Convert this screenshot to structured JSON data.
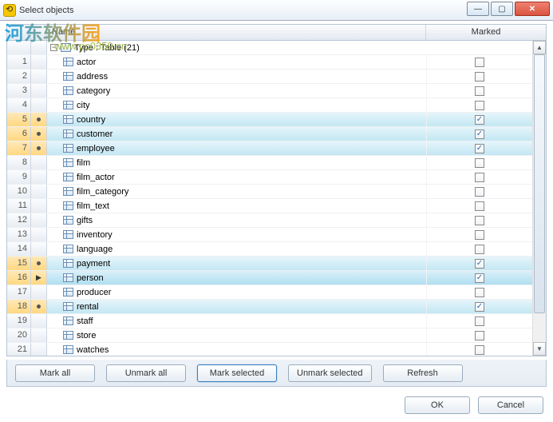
{
  "window": {
    "title": "Select objects"
  },
  "watermark": {
    "text": "河东软件园",
    "url": "www.pc0359.cn"
  },
  "columns": {
    "name": "Name",
    "marked": "Marked"
  },
  "group": {
    "label": "Type : Table (21)"
  },
  "rows": [
    {
      "n": "1",
      "name": "actor",
      "checked": false,
      "sel": false,
      "cur": false,
      "ind": ""
    },
    {
      "n": "2",
      "name": "address",
      "checked": false,
      "sel": false,
      "cur": false,
      "ind": ""
    },
    {
      "n": "3",
      "name": "category",
      "checked": false,
      "sel": false,
      "cur": false,
      "ind": ""
    },
    {
      "n": "4",
      "name": "city",
      "checked": false,
      "sel": false,
      "cur": false,
      "ind": ""
    },
    {
      "n": "5",
      "name": "country",
      "checked": true,
      "sel": true,
      "cur": false,
      "ind": "dot"
    },
    {
      "n": "6",
      "name": "customer",
      "checked": true,
      "sel": true,
      "cur": false,
      "ind": "dot"
    },
    {
      "n": "7",
      "name": "employee",
      "checked": true,
      "sel": true,
      "cur": false,
      "ind": "dot"
    },
    {
      "n": "8",
      "name": "film",
      "checked": false,
      "sel": false,
      "cur": false,
      "ind": ""
    },
    {
      "n": "9",
      "name": "film_actor",
      "checked": false,
      "sel": false,
      "cur": false,
      "ind": ""
    },
    {
      "n": "10",
      "name": "film_category",
      "checked": false,
      "sel": false,
      "cur": false,
      "ind": ""
    },
    {
      "n": "11",
      "name": "film_text",
      "checked": false,
      "sel": false,
      "cur": false,
      "ind": ""
    },
    {
      "n": "12",
      "name": "gifts",
      "checked": false,
      "sel": false,
      "cur": false,
      "ind": ""
    },
    {
      "n": "13",
      "name": "inventory",
      "checked": false,
      "sel": false,
      "cur": false,
      "ind": ""
    },
    {
      "n": "14",
      "name": "language",
      "checked": false,
      "sel": false,
      "cur": false,
      "ind": ""
    },
    {
      "n": "15",
      "name": "payment",
      "checked": true,
      "sel": true,
      "cur": false,
      "ind": "dot"
    },
    {
      "n": "16",
      "name": "person",
      "checked": true,
      "sel": true,
      "cur": true,
      "ind": "arrow"
    },
    {
      "n": "17",
      "name": "producer",
      "checked": false,
      "sel": false,
      "cur": false,
      "ind": ""
    },
    {
      "n": "18",
      "name": "rental",
      "checked": true,
      "sel": true,
      "cur": false,
      "ind": "dot"
    },
    {
      "n": "19",
      "name": "staff",
      "checked": false,
      "sel": false,
      "cur": false,
      "ind": ""
    },
    {
      "n": "20",
      "name": "store",
      "checked": false,
      "sel": false,
      "cur": false,
      "ind": ""
    },
    {
      "n": "21",
      "name": "watches",
      "checked": false,
      "sel": false,
      "cur": false,
      "ind": ""
    }
  ],
  "buttons": {
    "mark_all": "Mark all",
    "unmark_all": "Unmark all",
    "mark_selected": "Mark selected",
    "unmark_selected": "Unmark selected",
    "refresh": "Refresh",
    "ok": "OK",
    "cancel": "Cancel"
  }
}
